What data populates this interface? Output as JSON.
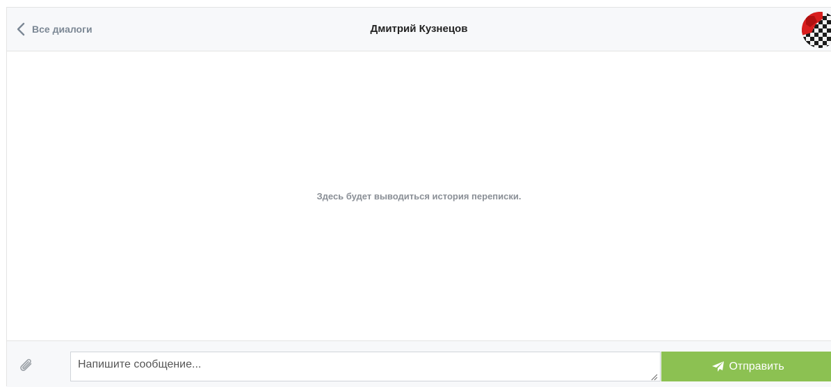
{
  "header": {
    "back_label": "Все диалоги",
    "title": "Дмитрий Кузнецов",
    "back_icon": "chevron-left-icon",
    "avatar_icon": "user-avatar"
  },
  "history": {
    "placeholder": "Здесь будет выводиться история переписки."
  },
  "composer": {
    "attach_icon": "paperclip-icon",
    "input_value": "",
    "input_placeholder": "Напишите сообщение...",
    "send_label": "Отправить",
    "send_icon": "paper-plane-icon"
  },
  "colors": {
    "header_bg": "#f7f8fa",
    "send_button": "#8cc152",
    "muted_text": "#7b8794"
  }
}
